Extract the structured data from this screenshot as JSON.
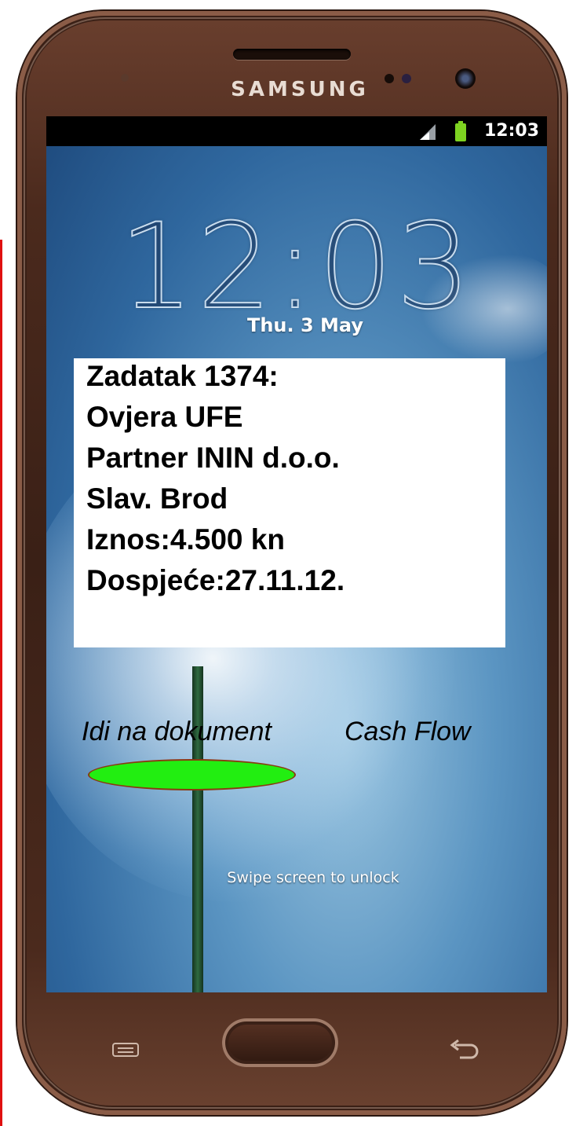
{
  "device": {
    "brand": "SAMSUNG"
  },
  "status_bar": {
    "time": "12:03",
    "signal_icon": "signal-icon",
    "battery_icon": "battery-icon"
  },
  "lock_screen": {
    "clock": "12:03",
    "date": "Thu. 3 May",
    "unlock_hint": "Swipe screen to unlock"
  },
  "task_card": {
    "lines": [
      "Zadatak 1374:",
      "Ovjera UFE",
      "Partner ININ d.o.o.",
      "Slav. Brod",
      "Iznos:4.500 kn",
      "Dospjeće:27.11.12."
    ],
    "go_to_document_label": "Idi na dokument",
    "cash_flow_label": "Cash Flow"
  },
  "colors": {
    "button_fill": "#22ee11",
    "button_border": "#8a3a10",
    "side_line": "#e01010"
  }
}
